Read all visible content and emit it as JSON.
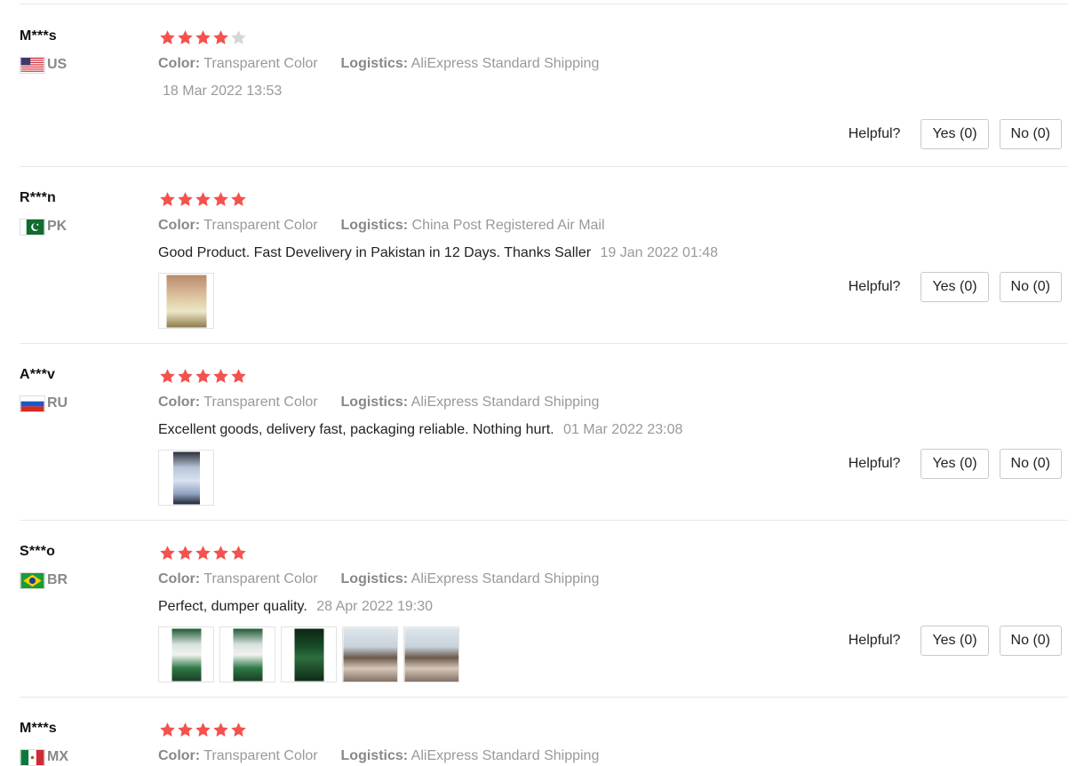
{
  "labels": {
    "color": "Color:",
    "logistics": "Logistics:",
    "helpful": "Helpful?"
  },
  "colors": {
    "star_filled": "#f4514f",
    "star_empty": "#d6d6d6"
  },
  "reviews": [
    {
      "user": "M***s",
      "country": "US",
      "flag_icon": "us-flag-icon",
      "rating": 4,
      "color": "Transparent Color",
      "logistics": "AliExpress Standard Shipping",
      "text": "",
      "date": "18 Mar 2022 13:53",
      "images": [],
      "yes": "Yes (0)",
      "no": "No (0)"
    },
    {
      "user": "R***n",
      "country": "PK",
      "flag_icon": "pakistan-flag-icon",
      "rating": 5,
      "color": "Transparent Color",
      "logistics": "China Post Registered Air Mail",
      "text": "Good Product. Fast Develivery in Pakistan in 12 Days. Thanks Saller",
      "date": "19 Jan 2022 01:48",
      "images": [
        "person-photo"
      ],
      "yes": "Yes (0)",
      "no": "No (0)"
    },
    {
      "user": "A***v",
      "country": "RU",
      "flag_icon": "russia-flag-icon",
      "rating": 5,
      "color": "Transparent Color",
      "logistics": "AliExpress Standard Shipping",
      "text": "Excellent goods, delivery fast, packaging reliable. Nothing hurt.",
      "date": "01 Mar 2022 23:08",
      "images": [
        "phone-case-photo"
      ],
      "yes": "Yes (0)",
      "no": "No (0)"
    },
    {
      "user": "S***o",
      "country": "BR",
      "flag_icon": "brazil-flag-icon",
      "rating": 5,
      "color": "Transparent Color",
      "logistics": "AliExpress Standard Shipping",
      "text": "Perfect, dumper quality.",
      "date": "28 Apr 2022 19:30",
      "images": [
        "green-case-photo",
        "green-case-photo",
        "dark-green-case-photo",
        "couple-photo",
        "couple-photo"
      ],
      "yes": "Yes (0)",
      "no": "No (0)"
    },
    {
      "user": "M***s",
      "country": "MX",
      "flag_icon": "mexico-flag-icon",
      "rating": 5,
      "color": "Transparent Color",
      "logistics": "AliExpress Standard Shipping",
      "text": "",
      "date": "",
      "images": [],
      "yes": "",
      "no": ""
    }
  ]
}
